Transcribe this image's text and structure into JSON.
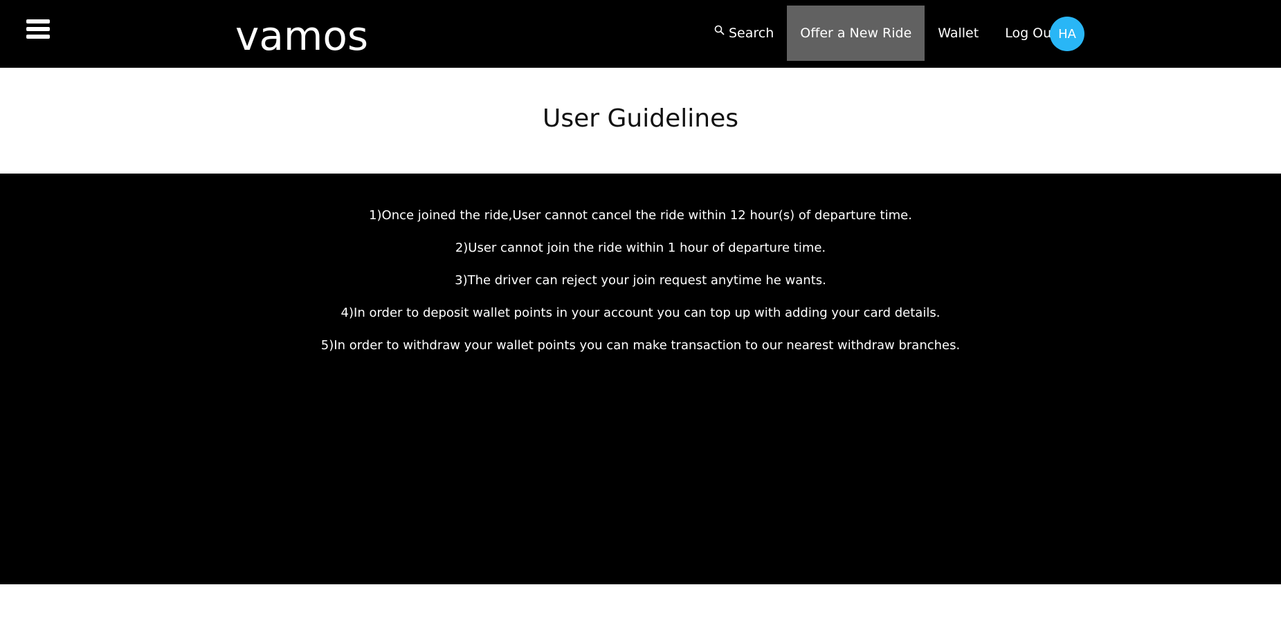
{
  "brand": {
    "name": "vamos"
  },
  "nav": {
    "search_label": "Search",
    "offer_label": "Offer a New Ride",
    "wallet_label": "Wallet",
    "logout_label": "Log Out",
    "avatar_initials": "HA",
    "icons": {
      "menu": "hamburger-menu-icon",
      "search": "search-icon"
    }
  },
  "page": {
    "title": "User Guidelines"
  },
  "guidelines": [
    "1)Once joined the ride,User cannot cancel the ride within 12 hour(s) of departure time.",
    "2)User cannot join the ride within 1 hour of departure time.",
    "3)The driver can reject your join request anytime he wants.",
    "4)In order to deposit wallet points in your account you can top up with adding your card details.",
    "5)In order to withdraw your wallet points you can make transaction to our nearest withdraw branches."
  ],
  "colors": {
    "navbar_bg": "#000000",
    "active_nav_bg": "#616161",
    "avatar_bg": "#29b6f6",
    "content_bg": "#000000",
    "title_band_bg": "#ffffff"
  }
}
